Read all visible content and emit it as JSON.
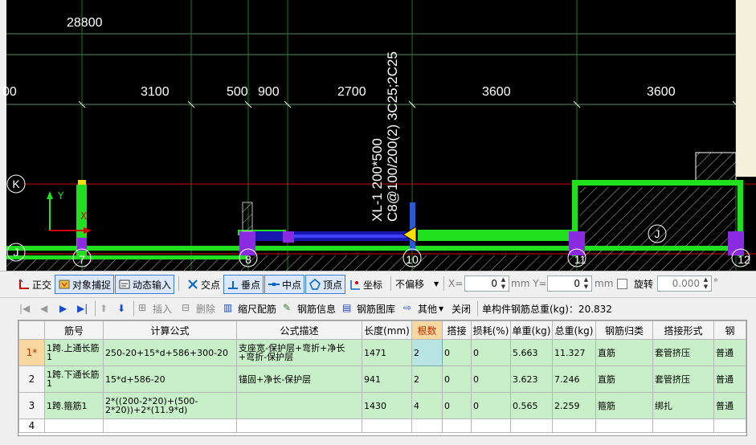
{
  "cad": {
    "dimensions": {
      "total": "28800",
      "spans": [
        "00",
        "3100",
        "500",
        "900",
        "2700",
        "3600",
        "3600"
      ]
    },
    "beam_annotation": {
      "line1": "XL-1 200*500",
      "line2": "C8@100/200(2) 3C25;2C25"
    },
    "axis_labels": {
      "K": "K",
      "J_left": "J",
      "J_right": "J",
      "n7": "7",
      "n8": "8",
      "n10": "10",
      "n11": "11",
      "n12": "12"
    },
    "ucs": {
      "y": "Y",
      "x": "X"
    }
  },
  "toolbar_snap": {
    "ortho": "正交",
    "object_snap": "对象捕捉",
    "dynamic_input": "动态输入",
    "intersection": "交点",
    "perpendicular": "垂点",
    "midpoint": "中点",
    "vertex": "顶点",
    "coordinate": "坐标",
    "offset_mode": "不偏移",
    "x_label": "X=",
    "x_value": "0",
    "y_label": "mm Y=",
    "y_value": "0",
    "mm": "mm",
    "rotate": "旋转",
    "rotate_value": "0.000",
    "degree": "°"
  },
  "toolbar_rebar": {
    "insert": "插入",
    "delete": "删除",
    "scale_rebar": "缩尺配筋",
    "rebar_info": "钢筋信息",
    "rebar_library": "钢筋图库",
    "other": "其他",
    "close": "关闭",
    "total_weight": "单构件钢筋总重(kg)：20.832"
  },
  "table": {
    "headers": [
      "",
      "筋号",
      "计算公式",
      "公式描述",
      "长度(mm)",
      "根数",
      "搭接",
      "损耗(%)",
      "单重(kg)",
      "总重(kg)",
      "钢筋归类",
      "搭接形式",
      "钢"
    ],
    "rows": [
      [
        "1*",
        "1跨.上通长筋1",
        "250-20+15*d+586+300-20",
        "支座宽-保护层+弯折+净长+弯折-保护层",
        "1471",
        "2",
        "0",
        "0",
        "5.663",
        "11.327",
        "直筋",
        "套管挤压",
        "普通"
      ],
      [
        "2",
        "1跨.下通长筋1",
        "15*d+586-20",
        "锚固+净长-保护层",
        "941",
        "2",
        "0",
        "0",
        "3.623",
        "7.246",
        "直筋",
        "套管挤压",
        "普通"
      ],
      [
        "3",
        "1跨.箍筋1",
        "2*((200-2*20)+(500-2*20))+2*(11.9*d)",
        "",
        "1430",
        "4",
        "0",
        "0",
        "0.565",
        "2.259",
        "箍筋",
        "绑扎",
        "普通"
      ],
      [
        "4",
        "",
        "",
        "",
        "",
        "",
        "",
        "",
        "",
        "",
        "",
        "",
        ""
      ]
    ]
  },
  "colors": {
    "grid_line": "#008000",
    "axis_red": "#d00000",
    "beam_green": "#20e020",
    "column_purple": "#8a2be2",
    "rebar_blue": "#2020c0",
    "row_green": "#c8f0c8"
  }
}
